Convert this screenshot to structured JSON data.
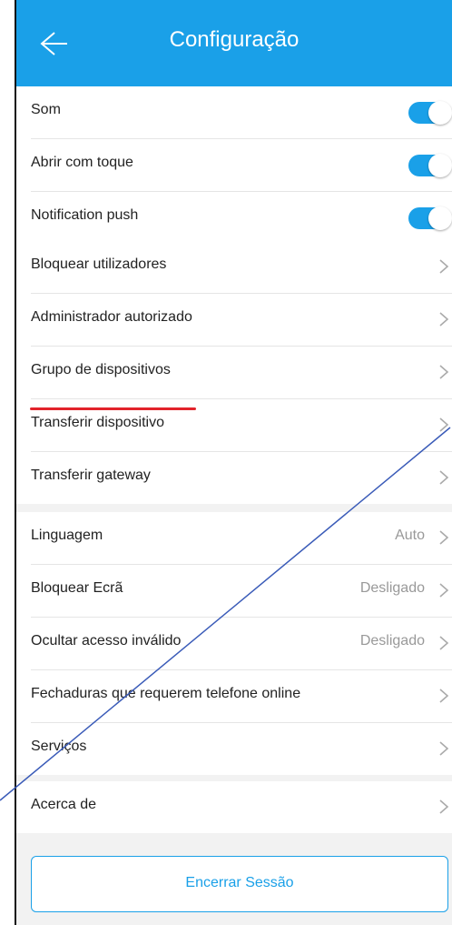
{
  "header": {
    "title": "Configuração"
  },
  "toggles": [
    {
      "label": "Som",
      "on": true
    },
    {
      "label": "Abrir com toque",
      "on": true
    },
    {
      "label": "Notification push",
      "on": true
    }
  ],
  "manage": [
    {
      "label": "Bloquear utilizadores"
    },
    {
      "label": "Administrador autorizado"
    },
    {
      "label": "Grupo de dispositivos"
    },
    {
      "label": "Transferir dispositivo"
    },
    {
      "label": "Transferir gateway"
    }
  ],
  "prefs": [
    {
      "label": "Linguagem",
      "value": "Auto"
    },
    {
      "label": "Bloquear Ecrã",
      "value": "Desligado"
    },
    {
      "label": "Ocultar acesso inválido",
      "value": "Desligado"
    },
    {
      "label": "Fechaduras que requerem telefone online",
      "value": ""
    },
    {
      "label": "Serviços",
      "value": ""
    }
  ],
  "about": {
    "label": "Acerca de"
  },
  "logout": {
    "label": "Encerrar Sessão"
  },
  "colors": {
    "accent": "#1aa0e8",
    "annotation": "#e2232b"
  }
}
